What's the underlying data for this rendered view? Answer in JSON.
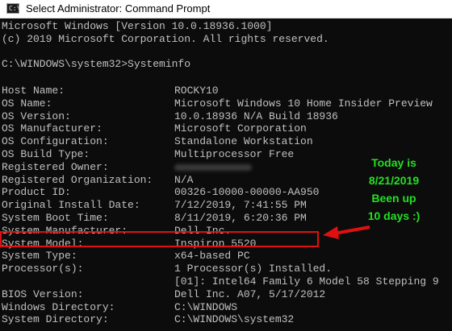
{
  "window": {
    "title": "Select Administrator: Command Prompt",
    "icon": "cmd-icon"
  },
  "console": {
    "header": [
      "Microsoft Windows [Version 10.0.18936.1000]",
      "(c) 2019 Microsoft Corporation. All rights reserved."
    ],
    "command": "C:\\WINDOWS\\system32>Systeminfo",
    "rows": [
      {
        "label": "Host Name:",
        "value": "ROCKY10"
      },
      {
        "label": "OS Name:",
        "value": "Microsoft Windows 10 Home Insider Preview"
      },
      {
        "label": "OS Version:",
        "value": "10.0.18936 N/A Build 18936"
      },
      {
        "label": "OS Manufacturer:",
        "value": "Microsoft Corporation"
      },
      {
        "label": "OS Configuration:",
        "value": "Standalone Workstation"
      },
      {
        "label": "OS Build Type:",
        "value": "Multiprocessor Free"
      },
      {
        "label": "Registered Owner:",
        "value": ""
      },
      {
        "label": "Registered Organization:",
        "value": "N/A"
      },
      {
        "label": "Product ID:",
        "value": "00326-10000-00000-AA950"
      },
      {
        "label": "Original Install Date:",
        "value": "7/12/2019, 7:41:55 PM"
      },
      {
        "label": "System Boot Time:",
        "value": "8/11/2019, 6:20:36 PM"
      },
      {
        "label": "System Manufacturer:",
        "value": "Dell Inc."
      },
      {
        "label": "System Model:",
        "value": "Inspiron 5520"
      },
      {
        "label": "System Type:",
        "value": "x64-based PC"
      },
      {
        "label": "Processor(s):",
        "value": "1 Processor(s) Installed."
      },
      {
        "label": "",
        "value": "[01]: Intel64 Family 6 Model 58 Stepping 9"
      },
      {
        "label": "BIOS Version:",
        "value": "Dell Inc. A07, 5/17/2012"
      },
      {
        "label": "Windows Directory:",
        "value": "C:\\WINDOWS"
      },
      {
        "label": "System Directory:",
        "value": "C:\\WINDOWS\\system32"
      }
    ]
  },
  "annotation": {
    "lines": [
      "Today is",
      "8/21/2019",
      "Been up",
      "10 days :)"
    ],
    "text_color": "#22e022",
    "box_color": "#e01010"
  }
}
